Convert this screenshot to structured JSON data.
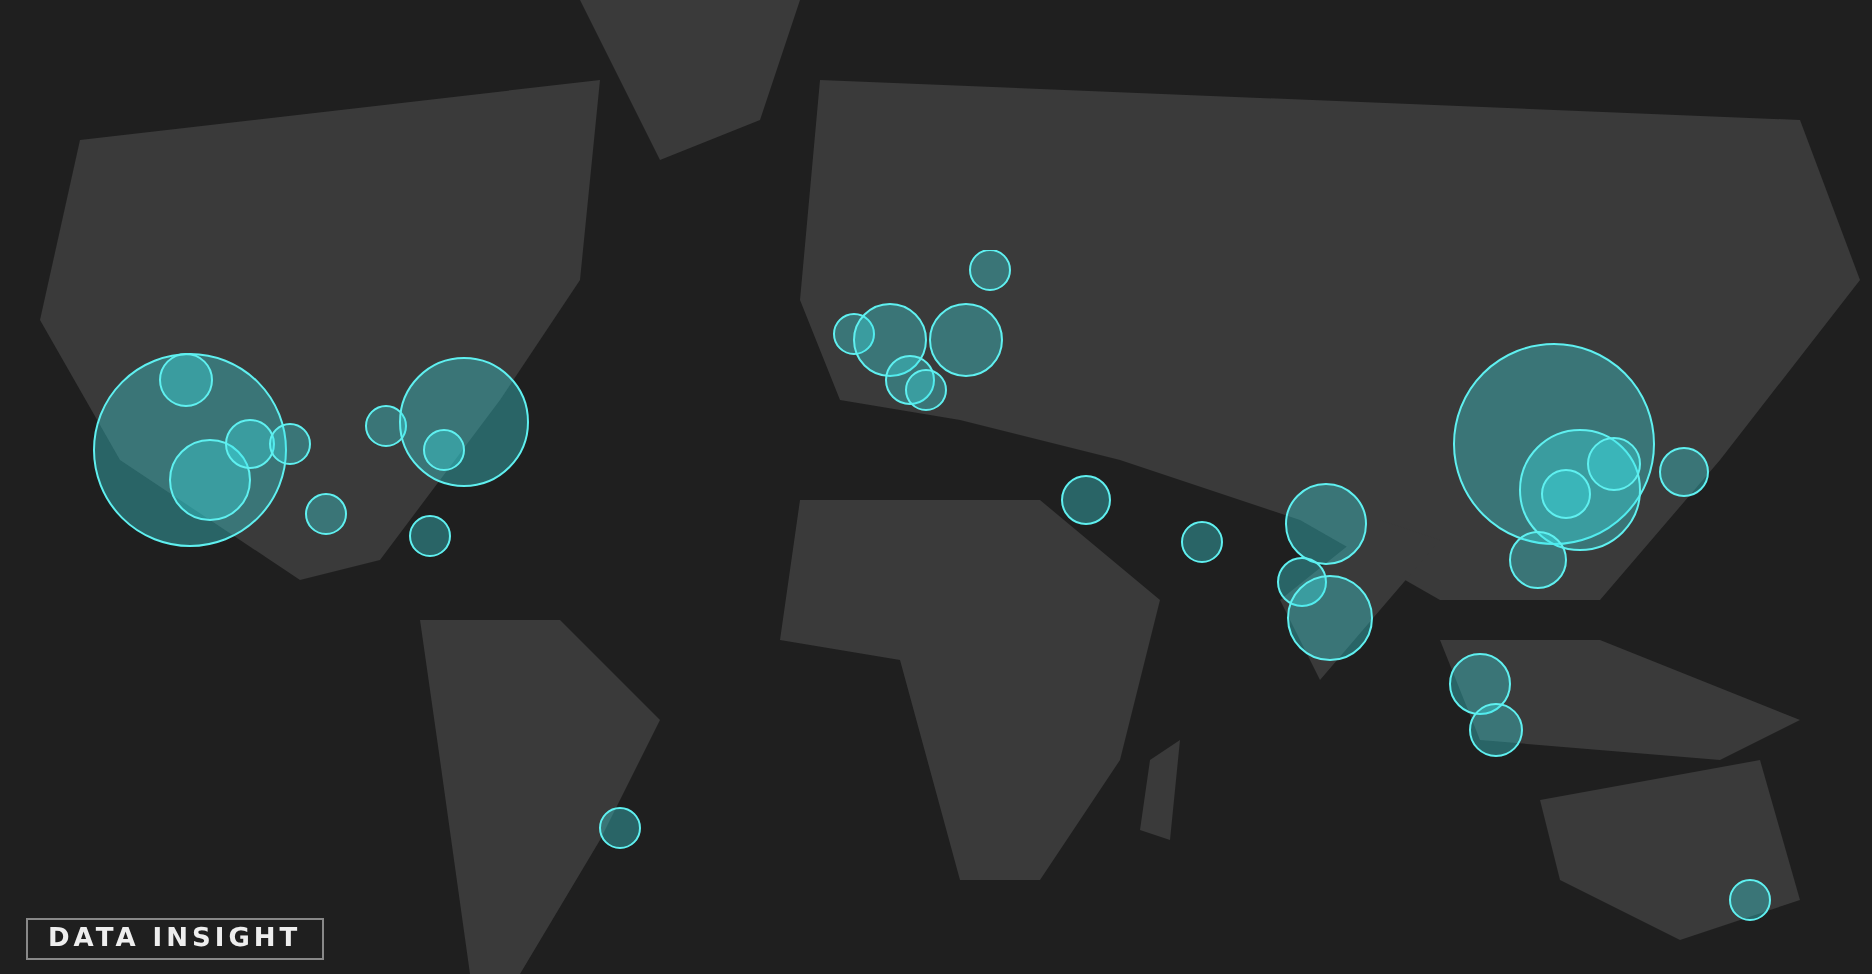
{
  "logo": {
    "text": "DATA INSIGHT"
  }
}
